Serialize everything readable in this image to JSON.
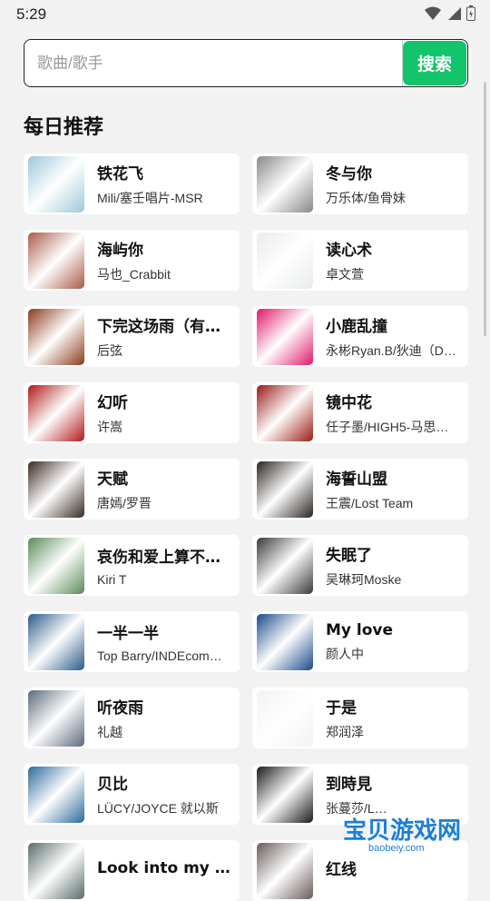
{
  "status": {
    "time": "5:29"
  },
  "search": {
    "placeholder": "歌曲/歌手",
    "button_label": "搜索"
  },
  "section": {
    "title": "每日推荐"
  },
  "songs": [
    {
      "title": "铁花飞",
      "artist": "Mili/塞壬唱片-MSR",
      "cover": "#9ec8d8"
    },
    {
      "title": "冬与你",
      "artist": "万乐体/鱼骨妹",
      "cover": "#888888"
    },
    {
      "title": "海屿你",
      "artist": "马也_Crabbit",
      "cover": "#a85a4a"
    },
    {
      "title": "读心术",
      "artist": "卓文萱",
      "cover": "#e8ece8"
    },
    {
      "title": "下完这场雨（有…",
      "artist": "后弦",
      "cover": "#8a3a1c"
    },
    {
      "title": "小鹿乱撞",
      "artist": "永彬Ryan.B/狄迪（D…",
      "cover": "#e0186a"
    },
    {
      "title": "幻听",
      "artist": "许嵩",
      "cover": "#b01818"
    },
    {
      "title": "镜中花",
      "artist": "任子墨/HIGH5-马思…",
      "cover": "#9a1a14"
    },
    {
      "title": "天赋",
      "artist": "唐嫣/罗晋",
      "cover": "#3a2a22"
    },
    {
      "title": "海誓山盟",
      "artist": "王震/Lost Team",
      "cover": "#2a2420"
    },
    {
      "title": "哀伤和爱上算不…",
      "artist": "Kiri T",
      "cover": "#5a8a5a"
    },
    {
      "title": "失眠了",
      "artist": "吴琳珂Moske",
      "cover": "#3a3a3a"
    },
    {
      "title": "一半一半",
      "artist": "Top Barry/INDEcom…",
      "cover": "#2a5a8a"
    },
    {
      "title": "My love",
      "artist": "颜人中",
      "cover": "#1a4a8a"
    },
    {
      "title": "听夜雨",
      "artist": "礼越",
      "cover": "#5a6a7a"
    },
    {
      "title": "于是",
      "artist": "郑润泽",
      "cover": "#f2f2f2"
    },
    {
      "title": "贝比",
      "artist": "LÜCY/JOYCE 就以斯",
      "cover": "#2a6a9a"
    },
    {
      "title": "到時見",
      "artist": "张蔓莎/L…",
      "cover": "#1a1a1a"
    },
    {
      "title": "Look into my eyes",
      "artist": "",
      "cover": "#5a6a6a"
    },
    {
      "title": "红线",
      "artist": "",
      "cover": "#6a5a5a"
    }
  ],
  "watermark": {
    "text": "宝贝游戏网",
    "sub": "baobeiy.com"
  }
}
